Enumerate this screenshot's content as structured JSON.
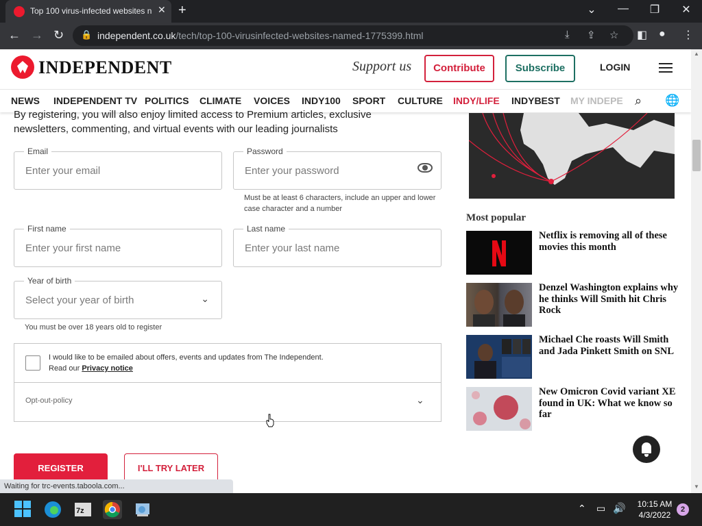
{
  "browser": {
    "tab_title": "Top 100 virus-infected websites n",
    "url_host": "independent.co.uk",
    "url_path": "/tech/top-100-virusinfected-websites-named-1775399.html"
  },
  "header": {
    "logo_text": "INDEPENDENT",
    "support_text": "Support us",
    "contribute_label": "Contribute",
    "subscribe_label": "Subscribe",
    "login_label": "LOGIN"
  },
  "nav": {
    "items": [
      "NEWS",
      "INDEPENDENT TV",
      "POLITICS",
      "CLIMATE",
      "VOICES",
      "INDY100",
      "SPORT",
      "CULTURE",
      "INDY/LIFE",
      "INDYBEST",
      "MY INDEPE"
    ]
  },
  "form": {
    "intro": "By registering, you will also enjoy limited access to Premium articles, exclusive newsletters, commenting, and virtual events with our leading journalists",
    "email": {
      "label": "Email",
      "placeholder": "Enter your email"
    },
    "password": {
      "label": "Password",
      "placeholder": "Enter your password",
      "hint": "Must be at least 6 characters, include an upper and lower case character and a number"
    },
    "first_name": {
      "label": "First name",
      "placeholder": "Enter your first name"
    },
    "last_name": {
      "label": "Last name",
      "placeholder": "Enter your last name"
    },
    "year_of_birth": {
      "label": "Year of birth",
      "placeholder": "Select your year of birth",
      "hint": "You must be over 18 years old to register"
    },
    "optin_text_1": "I would like to be emailed about offers, events and updates from The Independent.",
    "optin_text_2_prefix": "Read our ",
    "privacy_link": "Privacy notice",
    "optout_label": "Opt-out-policy",
    "register_label": "REGISTER",
    "later_label": "I'LL TRY LATER"
  },
  "sidebar": {
    "heading": "Most popular",
    "items": [
      {
        "title": "Netflix is removing all of these movies this month"
      },
      {
        "title": "Denzel Washington explains why he thinks Will Smith hit Chris Rock"
      },
      {
        "title": "Michael Che roasts Will Smith and Jada Pinkett Smith on SNL"
      },
      {
        "title": "New Omicron Covid variant XE found in UK: What we know so far"
      }
    ]
  },
  "status_text": "Waiting for trc-events.taboola.com...",
  "taskbar": {
    "time": "10:15 AM",
    "date": "4/3/2022",
    "notification_count": "2"
  },
  "colors": {
    "brand_red": "#e21f3c",
    "subscribe_green": "#1d6f62"
  }
}
